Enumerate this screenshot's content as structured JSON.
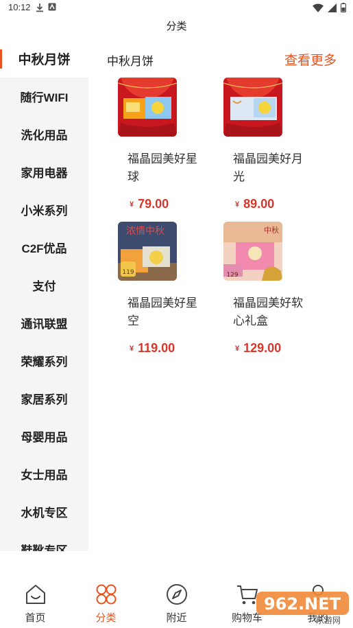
{
  "status_bar": {
    "time": "10:12"
  },
  "header": {
    "title": "分类"
  },
  "sidebar": {
    "items": [
      {
        "label": "中秋月饼",
        "active": true
      },
      {
        "label": "随行WIFI"
      },
      {
        "label": "洗化用品"
      },
      {
        "label": "家用电器"
      },
      {
        "label": "小米系列"
      },
      {
        "label": "C2F优品"
      },
      {
        "label": "支付"
      },
      {
        "label": "通讯联盟"
      },
      {
        "label": "荣耀系列"
      },
      {
        "label": "家居系列"
      },
      {
        "label": "母婴用品"
      },
      {
        "label": "女士用品"
      },
      {
        "label": "水机专区"
      },
      {
        "label": "鞋靴专区"
      }
    ]
  },
  "section": {
    "title": "中秋月饼",
    "more_label": "查看更多"
  },
  "products": [
    {
      "name": "福晶园美好星球",
      "currency": "¥",
      "price": "79.00"
    },
    {
      "name": "福晶园美好月光",
      "currency": "¥",
      "price": "89.00"
    },
    {
      "name": "福晶园美好星空",
      "currency": "¥",
      "price": "119.00",
      "badge_text": "119",
      "art_text": "浓情中秋"
    },
    {
      "name": "福晶园美好软心礼盒",
      "currency": "¥",
      "price": "129.00",
      "badge_text": "129",
      "art_text": "中秋"
    }
  ],
  "tabbar": {
    "items": [
      {
        "label": "首页",
        "icon": "home-icon"
      },
      {
        "label": "分类",
        "icon": "category-icon",
        "active": true
      },
      {
        "label": "附近",
        "icon": "compass-icon"
      },
      {
        "label": "购物车",
        "icon": "cart-icon"
      },
      {
        "label": "我的",
        "icon": "profile-icon"
      }
    ]
  },
  "watermark": {
    "text": "962.NET",
    "subtext": "乐游网"
  },
  "colors": {
    "accent": "#e8521e",
    "price": "#d9352a",
    "sidebar_bg": "#f5f5f5"
  }
}
